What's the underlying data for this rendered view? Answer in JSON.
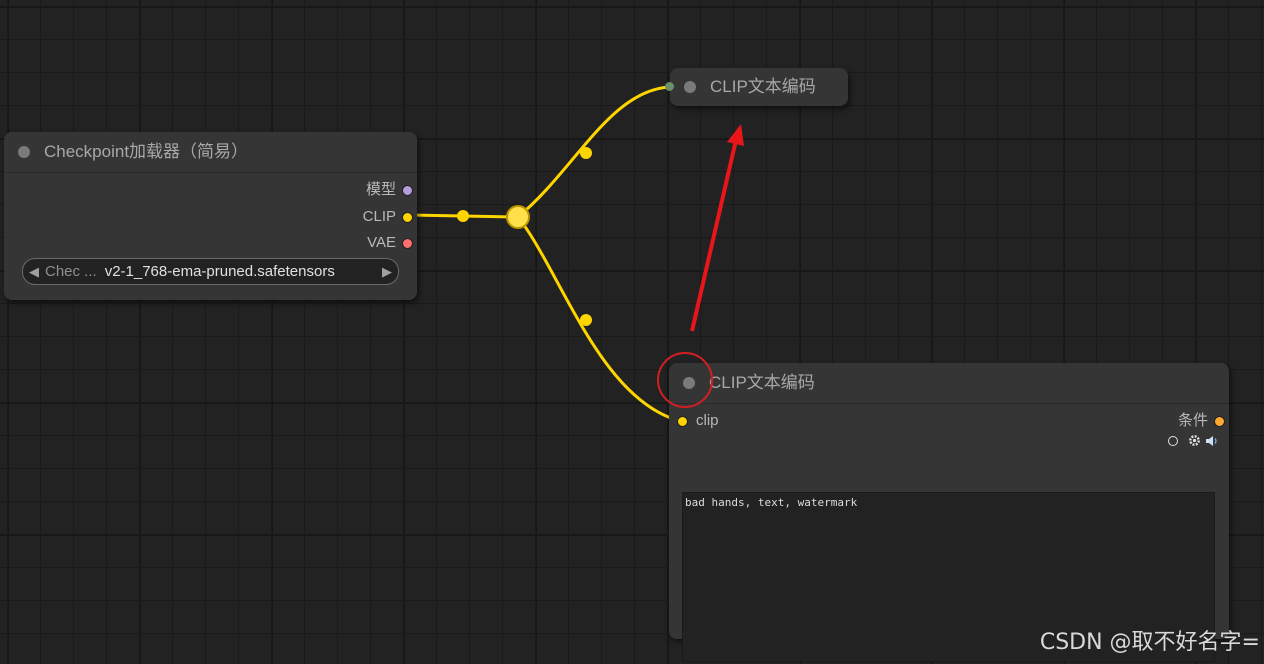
{
  "nodes": {
    "checkpoint_loader": {
      "title": "Checkpoint加载器（简易）",
      "outputs": [
        {
          "label": "模型",
          "color": "#b39ddb"
        },
        {
          "label": "CLIP",
          "color": "#ffd500"
        },
        {
          "label": "VAE",
          "color": "#ff6e6e"
        }
      ],
      "widget": {
        "label": "Chec ...",
        "value": "v2-1_768-ema-pruned.safetensors",
        "left_arrow": "◀",
        "right_arrow": "▶"
      }
    },
    "clip_text_encode_collapsed": {
      "title": "CLIP文本编码",
      "collapsed": true
    },
    "clip_text_encode": {
      "title": "CLIP文本编码",
      "input": {
        "label": "clip",
        "color": "#ffd500"
      },
      "output": {
        "label": "条件",
        "color": "#ffa931"
      },
      "icons": [
        "circle-outline-icon",
        "gear-icon",
        "speaker-icon"
      ],
      "text": "bad hands, text, watermark"
    }
  },
  "links": {
    "color": "#ffd500",
    "reroute": "clip-reroute-node"
  },
  "annotation": {
    "arrow_color": "#e8161b",
    "circle_color": "#d01f23"
  },
  "watermark": "CSDN @取不好名字="
}
